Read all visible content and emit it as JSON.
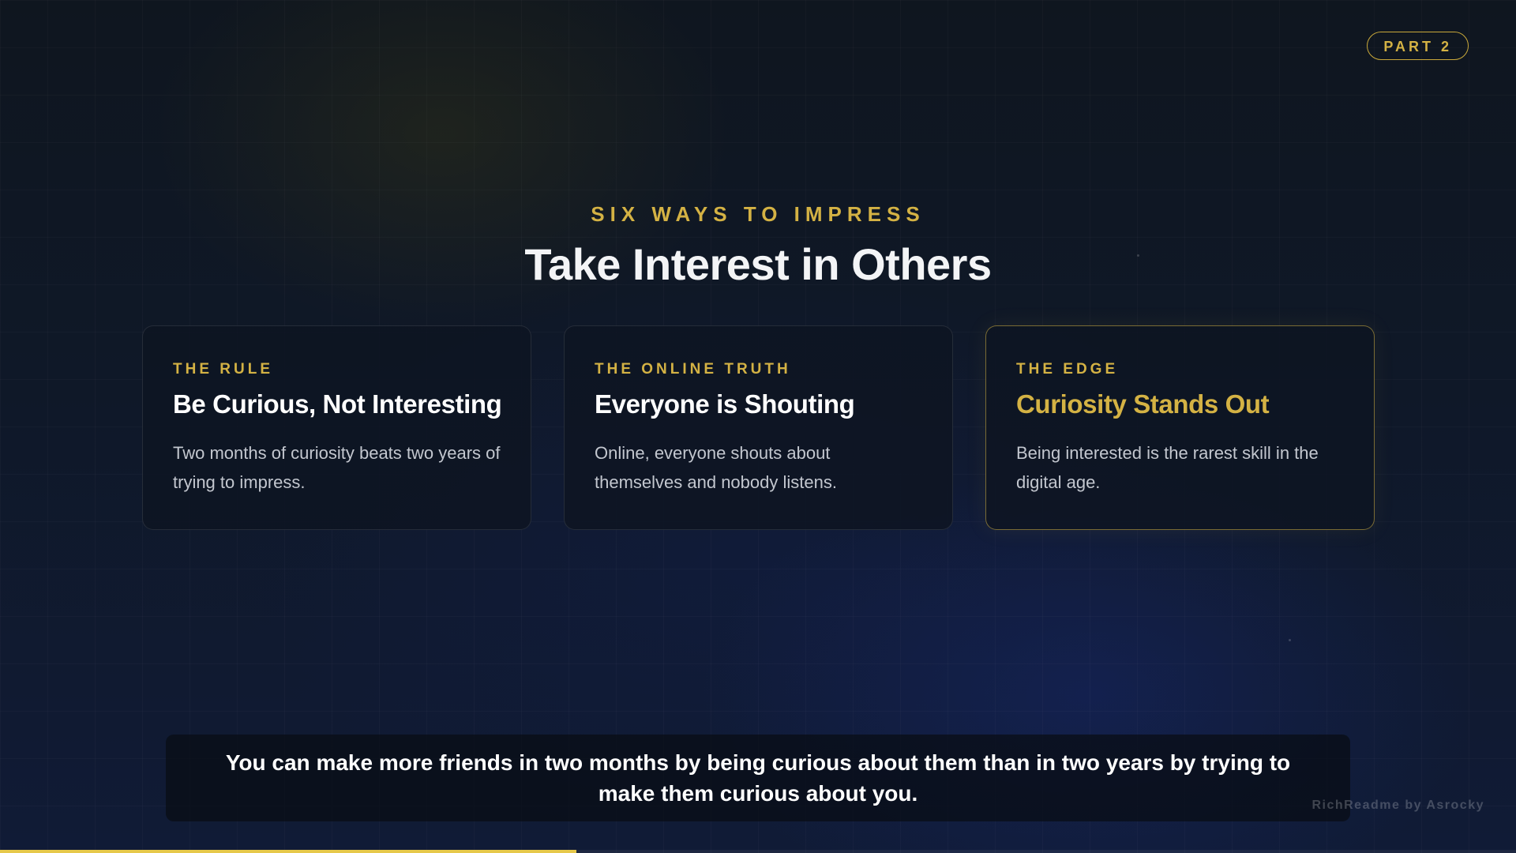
{
  "badge": {
    "label": "PART 2"
  },
  "header": {
    "eyebrow": "SIX WAYS TO IMPRESS",
    "title": "Take Interest in Others"
  },
  "cards": [
    {
      "kicker": "THE RULE",
      "title": "Be Curious, Not Interesting",
      "body": "Two months of curiosity beats two years of trying to impress.",
      "highlight": false
    },
    {
      "kicker": "THE ONLINE TRUTH",
      "title": "Everyone is Shouting",
      "body": "Online, everyone shouts about themselves and nobody listens.",
      "highlight": false
    },
    {
      "kicker": "THE EDGE",
      "title": "Curiosity Stands Out",
      "body": "Being interested is the rarest skill in the digital age.",
      "highlight": true
    }
  ],
  "quote": {
    "text": "You can make more friends in two months by being curious about them than in two years by trying to make them curious about you."
  },
  "watermark": {
    "text": "RichReadme by Asrocky"
  },
  "progress": {
    "fraction": 0.38
  },
  "colors": {
    "accent": "#d4b244",
    "progress": "#e6c84a",
    "background": "#0d1422"
  }
}
